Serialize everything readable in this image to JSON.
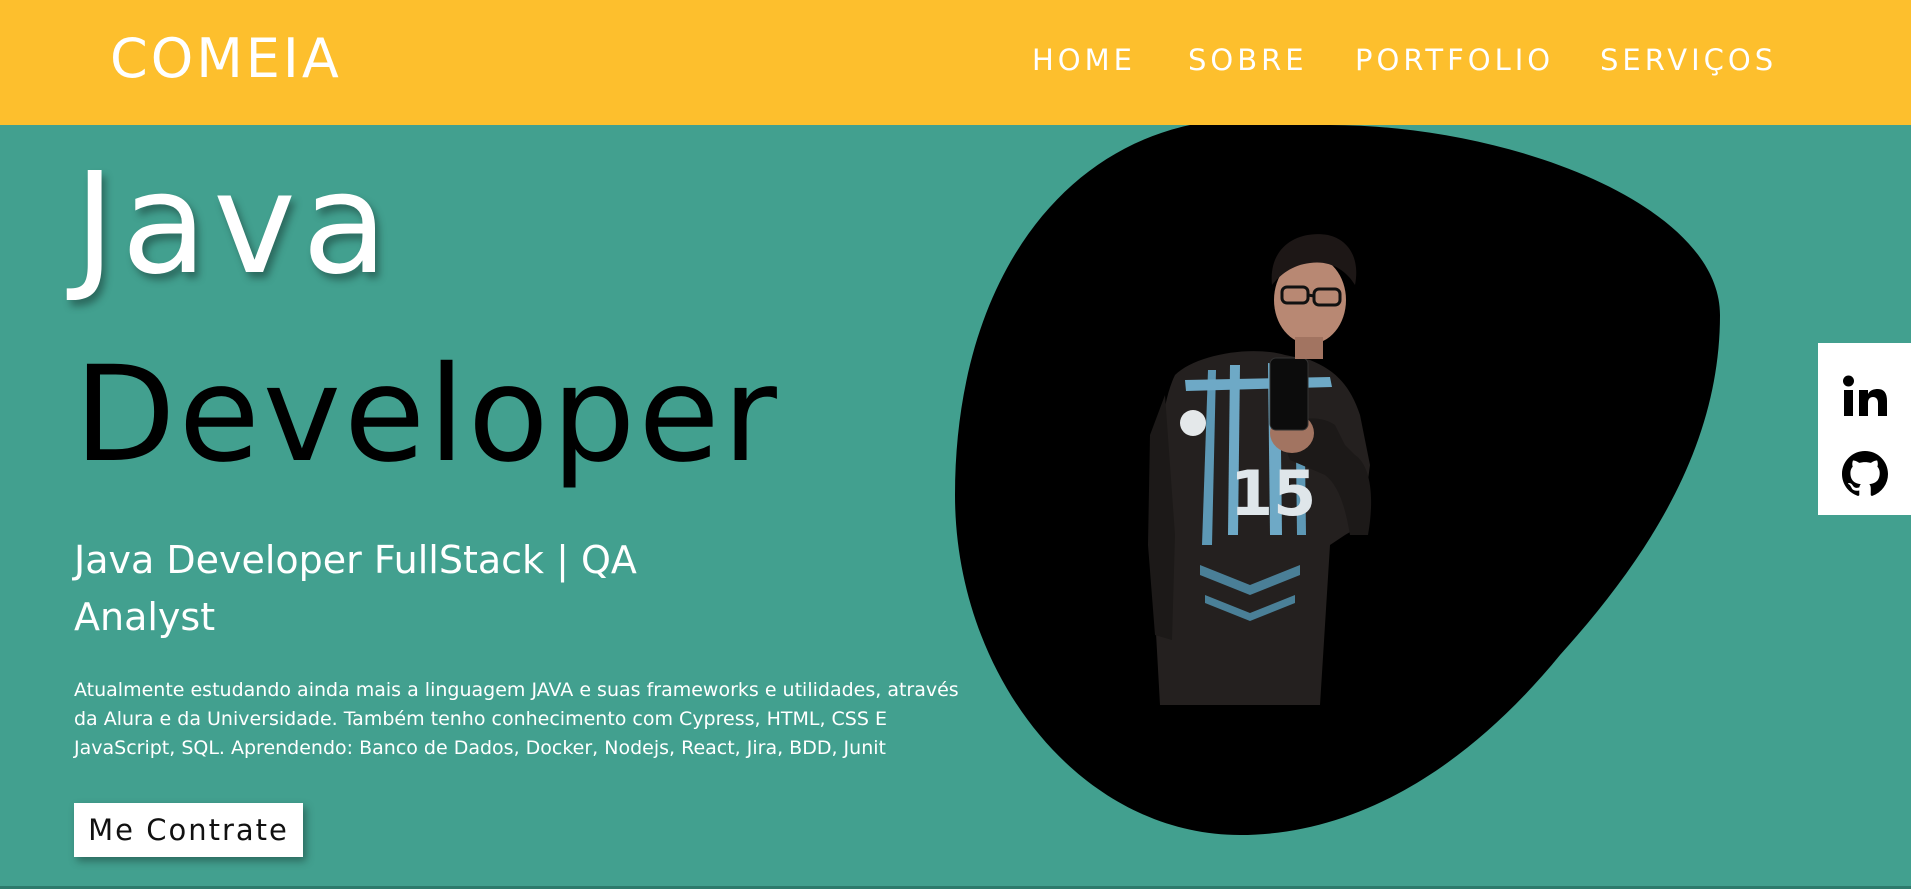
{
  "header": {
    "logo": "COMEIA",
    "background": "#fdbf2d",
    "nav": [
      {
        "label": "HOME"
      },
      {
        "label": "SOBRE"
      },
      {
        "label": "PORTFOLIO"
      },
      {
        "label": "SERVIÇOS"
      }
    ]
  },
  "hero": {
    "background": "#42a08f",
    "title_line_1": "Java",
    "title_line_2": "Developer",
    "subtitle": "Java Developer FullStack | QA Analyst",
    "description": "Atualmente estudando ainda mais a linguagem JAVA e suas frameworks e utilidades, através da Alura e da Universidade. Também tenho conhecimento com Cypress, HTML, CSS E JavaScript, SQL. Aprendendo: Banco de Dados, Docker, Nodejs, React, Jira, BDD, Junit",
    "cta_label": "Me Contrate",
    "photo_jersey_number": "15"
  },
  "social": {
    "icons": [
      "linkedin-icon",
      "github-icon"
    ]
  }
}
